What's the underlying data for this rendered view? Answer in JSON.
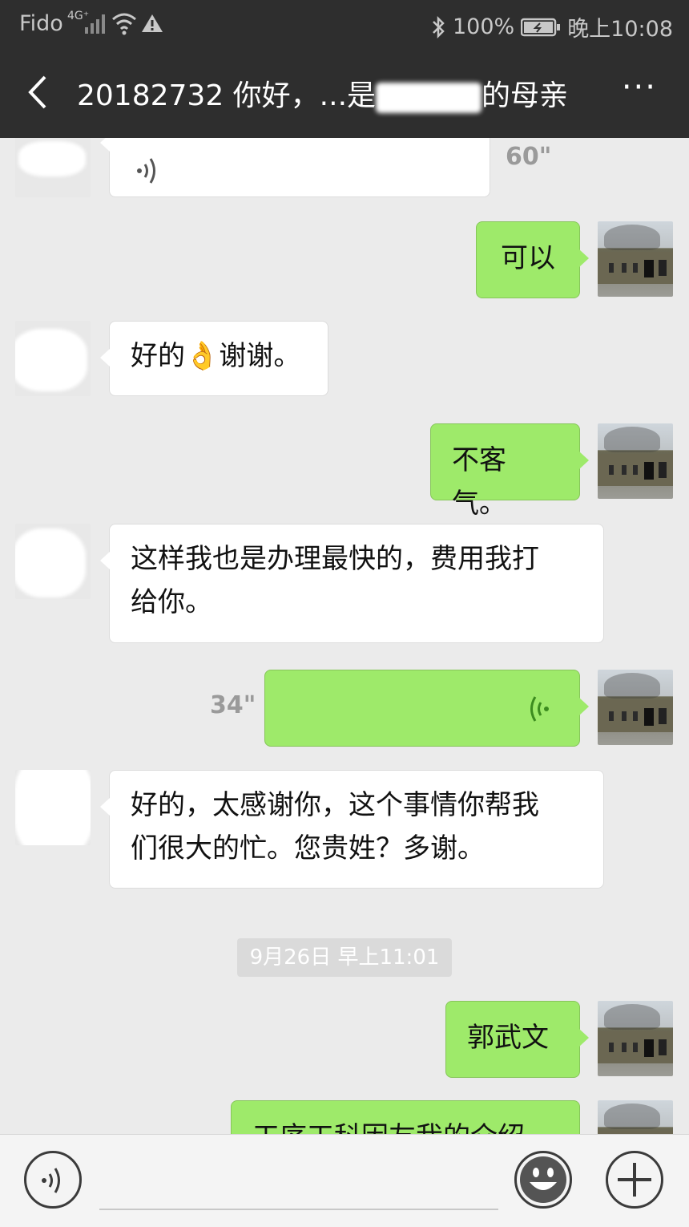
{
  "status_bar": {
    "carrier": "Fido",
    "network": "4G⁺",
    "battery": "100%",
    "time": "晚上10:08"
  },
  "header": {
    "title": "20182732 你好，...是",
    "title_suffix": "的母亲",
    "more_label": "···"
  },
  "messages": [
    {
      "side": "left",
      "type": "voice",
      "duration": "60\""
    },
    {
      "side": "right",
      "type": "text",
      "text": "可以"
    },
    {
      "side": "left",
      "type": "text",
      "text": "好的👌谢谢。"
    },
    {
      "side": "right",
      "type": "text",
      "text": "不客气。"
    },
    {
      "side": "left",
      "type": "text",
      "line1": "这样我也是办理最快的，费用我打",
      "line2": "给你。"
    },
    {
      "side": "right",
      "type": "voice",
      "duration": "34\""
    },
    {
      "side": "left",
      "type": "text",
      "line1": "好的，太感谢你，这个事情你帮我",
      "line2": "们很大的忙。您贵姓？多谢。"
    },
    {
      "side": "right",
      "type": "text",
      "text": "郭武文"
    },
    {
      "side": "right",
      "type": "text",
      "text": "工序工科因友我的介绍"
    }
  ],
  "timestamp": "9月26日 早上11:01",
  "colors": {
    "header_bg": "#2e2e2e",
    "chat_bg": "#ebebeb",
    "bubble_mine": "#9eea6a",
    "bubble_theirs": "#ffffff"
  },
  "icons": [
    "back-arrow-icon",
    "more-icon",
    "voice-wave-icon",
    "voice-input-icon",
    "emoji-icon",
    "plus-icon"
  ]
}
